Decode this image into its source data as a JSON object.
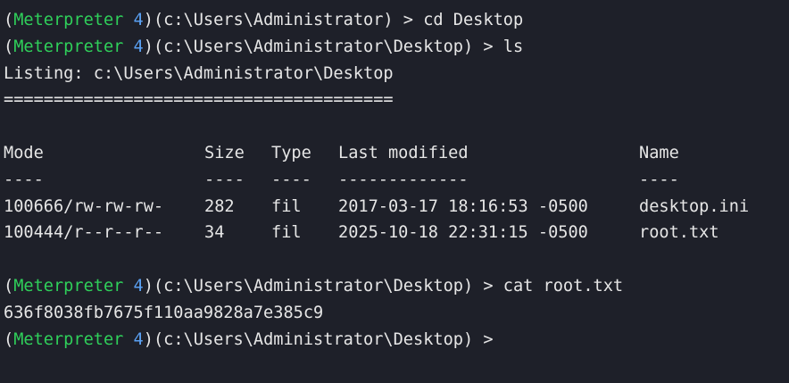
{
  "prompt": {
    "name": "Meterpreter",
    "session": "4"
  },
  "lines": [
    {
      "path": "c:\\Users\\Administrator",
      "command": "cd Desktop"
    },
    {
      "path": "c:\\Users\\Administrator\\Desktop",
      "command": "ls"
    }
  ],
  "listing": {
    "header": "Listing: c:\\Users\\Administrator\\Desktop",
    "underline": "=======================================",
    "columns": [
      "Mode",
      "Size",
      "Type",
      "Last modified",
      "Name"
    ],
    "separators": [
      "----",
      "----",
      "----",
      "-------------",
      "----"
    ],
    "rows": [
      [
        "100666/rw-rw-rw-",
        "282",
        "fil",
        "2017-03-17 18:16:53 -0500",
        "desktop.ini"
      ],
      [
        "100444/r--r--r--",
        "34",
        "fil",
        "2025-10-18 22:31:15 -0500",
        "root.txt"
      ]
    ]
  },
  "cat_line": {
    "path": "c:\\Users\\Administrator\\Desktop",
    "command": "cat root.txt"
  },
  "output": "636f8038fb7675f110aa9828a7e385c9",
  "final_prompt": {
    "path": "c:\\Users\\Administrator\\Desktop",
    "command": ""
  },
  "colors": {
    "background": "#1e2029",
    "prompt_name": "#2fcf5a",
    "session_number": "#5aa0f2",
    "text": "#e6e6e6"
  }
}
